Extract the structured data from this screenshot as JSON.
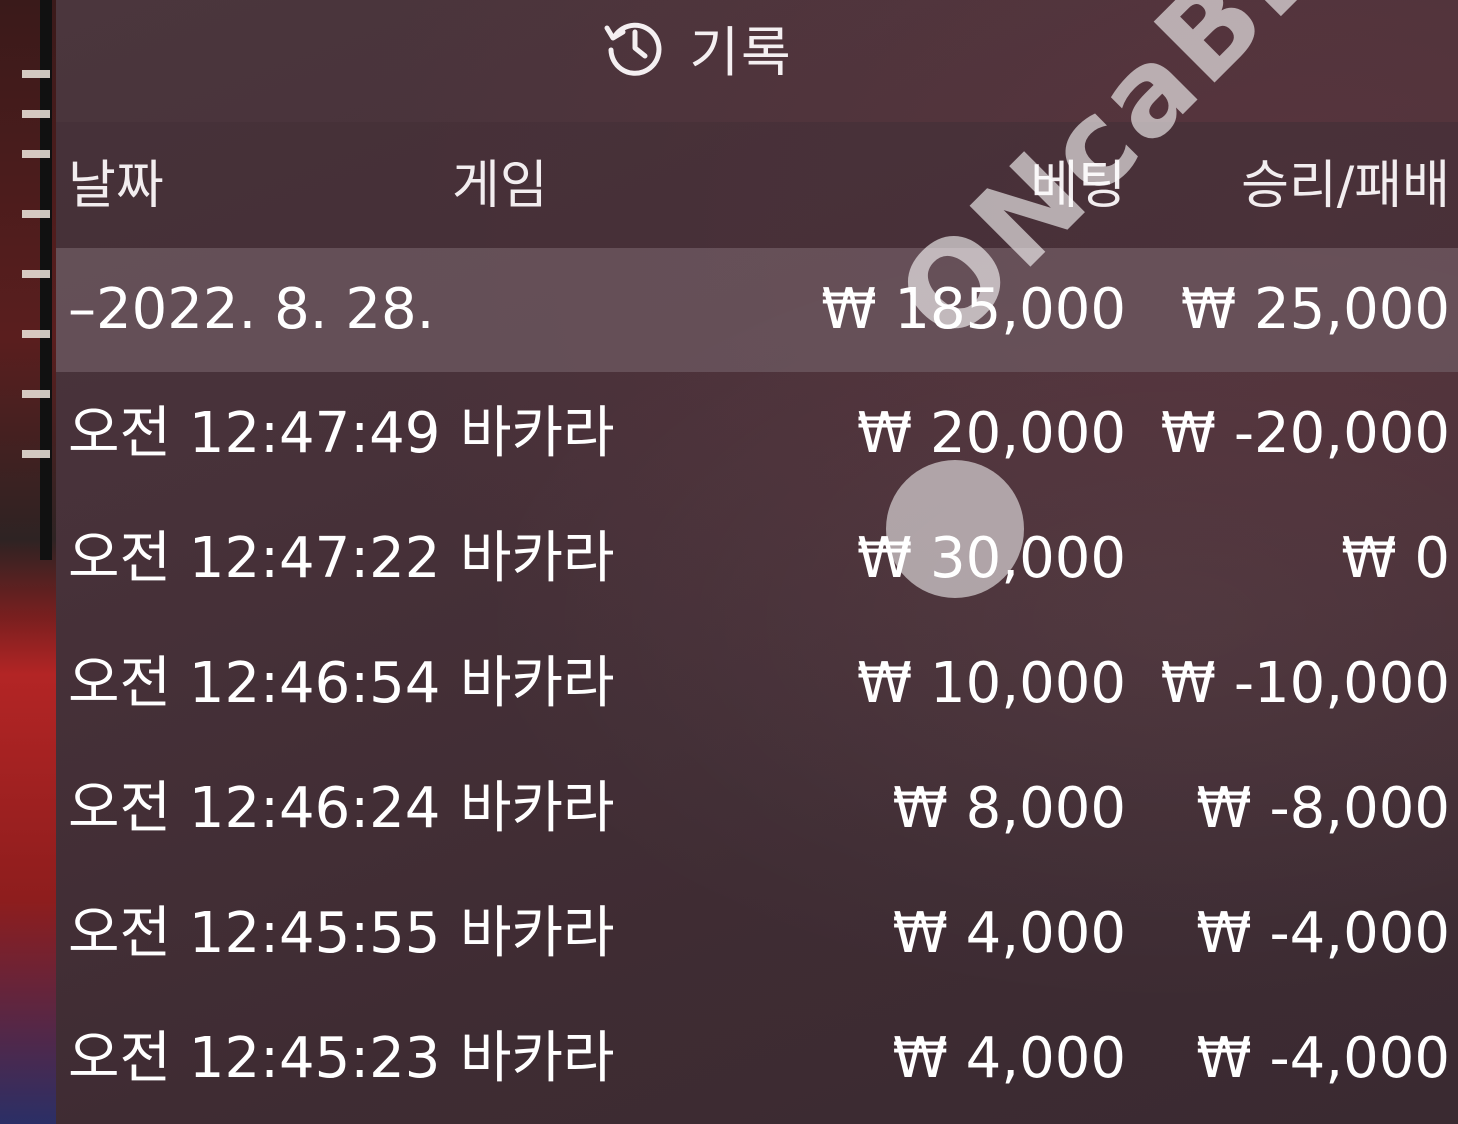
{
  "title": {
    "icon": "history-clock-icon",
    "label": "기록"
  },
  "columns": {
    "date": "날짜",
    "game": "게임",
    "bet": "베팅",
    "winloss": "승리/패배"
  },
  "summary": {
    "date": "–2022. 8. 28.",
    "bet": "₩ 185,000",
    "winloss": "₩ 25,000"
  },
  "rows": [
    {
      "time": "오전 12:47:49",
      "game": "바카라",
      "bet": "₩ 20,000",
      "winloss": "₩ -20,000"
    },
    {
      "time": "오전 12:47:22",
      "game": "바카라",
      "bet": "₩ 30,000",
      "winloss": "₩ 0"
    },
    {
      "time": "오전 12:46:54",
      "game": "바카라",
      "bet": "₩ 10,000",
      "winloss": "₩ -10,000"
    },
    {
      "time": "오전 12:46:24",
      "game": "바카라",
      "bet": "₩ 8,000",
      "winloss": "₩ -8,000"
    },
    {
      "time": "오전 12:45:55",
      "game": "바카라",
      "bet": "₩ 4,000",
      "winloss": "₩ -4,000"
    },
    {
      "time": "오전 12:45:23",
      "game": "바카라",
      "bet": "₩ 4,000",
      "winloss": "₩ -4,000"
    }
  ],
  "watermark": {
    "text": "ONcaBEST"
  },
  "colors": {
    "panel": "#45323a",
    "header": "#46303a",
    "summary": "#6e5a62",
    "text": "#ffffff"
  }
}
